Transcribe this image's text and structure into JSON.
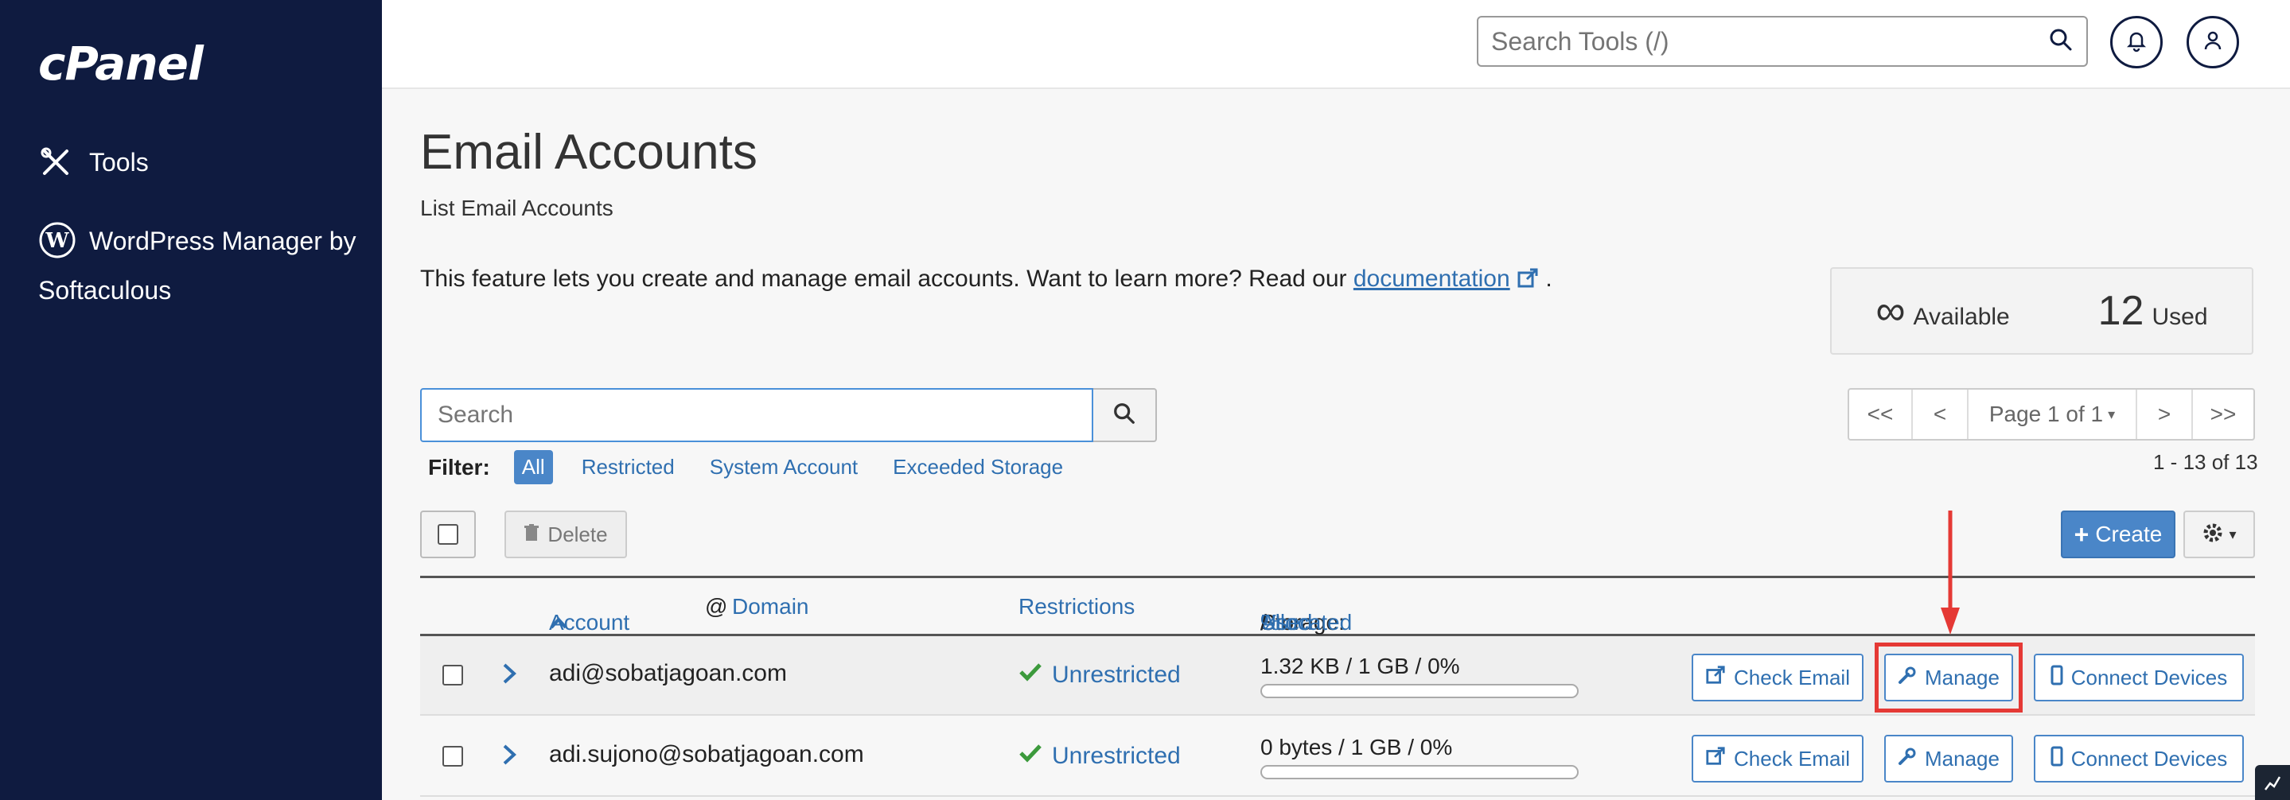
{
  "sidebar": {
    "logo": "cPanel",
    "items": [
      {
        "label": "Tools",
        "icon": "tools-icon"
      },
      {
        "label": "WordPress Manager by Softaculous",
        "icon": "wordpress-icon"
      }
    ]
  },
  "topbar": {
    "search_placeholder": "Search Tools (/)"
  },
  "page": {
    "title": "Email Accounts",
    "subtitle": "List Email Accounts",
    "description": "This feature lets you create and manage email accounts. Want to learn more? Read our ",
    "doc_link": "documentation",
    "desc_end": "."
  },
  "stats": {
    "available_value": "∞",
    "available_label": "Available",
    "used_value": "12",
    "used_label": "Used"
  },
  "search": {
    "placeholder": "Search"
  },
  "filter": {
    "label": "Filter:",
    "active": "All",
    "options": [
      "Restricted",
      "System Account",
      "Exceeded Storage"
    ]
  },
  "pager": {
    "first": "<<",
    "prev": "<",
    "page": "Page 1 of 1",
    "next": ">",
    "last": ">>",
    "range": "1 - 13 of 13"
  },
  "toolbar": {
    "delete_label": "Delete",
    "create_label": "Create"
  },
  "table": {
    "headers": {
      "account": "Account",
      "at": "@",
      "domain": "Domain",
      "restrictions": "Restrictions",
      "storage": "Storage:",
      "used": "Used",
      "slash1": "/",
      "allocated": "Allocated",
      "slash2": "/",
      "percent": "%"
    },
    "rows": [
      {
        "email": "adi@sobatjagoan.com",
        "restriction": "Unrestricted",
        "storage": "1.32 KB / 1 GB / 0%",
        "usage_fraction": 0.0
      },
      {
        "email": "adi.sujono@sobatjagoan.com",
        "restriction": "Unrestricted",
        "storage": "0 bytes / 1 GB / 0%",
        "usage_fraction": 0.0
      }
    ],
    "actions": {
      "check_email": "Check Email",
      "manage": "Manage",
      "connect_devices": "Connect Devices"
    }
  },
  "colors": {
    "sidebar": "#0f1b40",
    "accent": "#4a86c8",
    "link": "#2f6fb0",
    "success": "#3c9a3c",
    "highlight": "#e53935"
  }
}
